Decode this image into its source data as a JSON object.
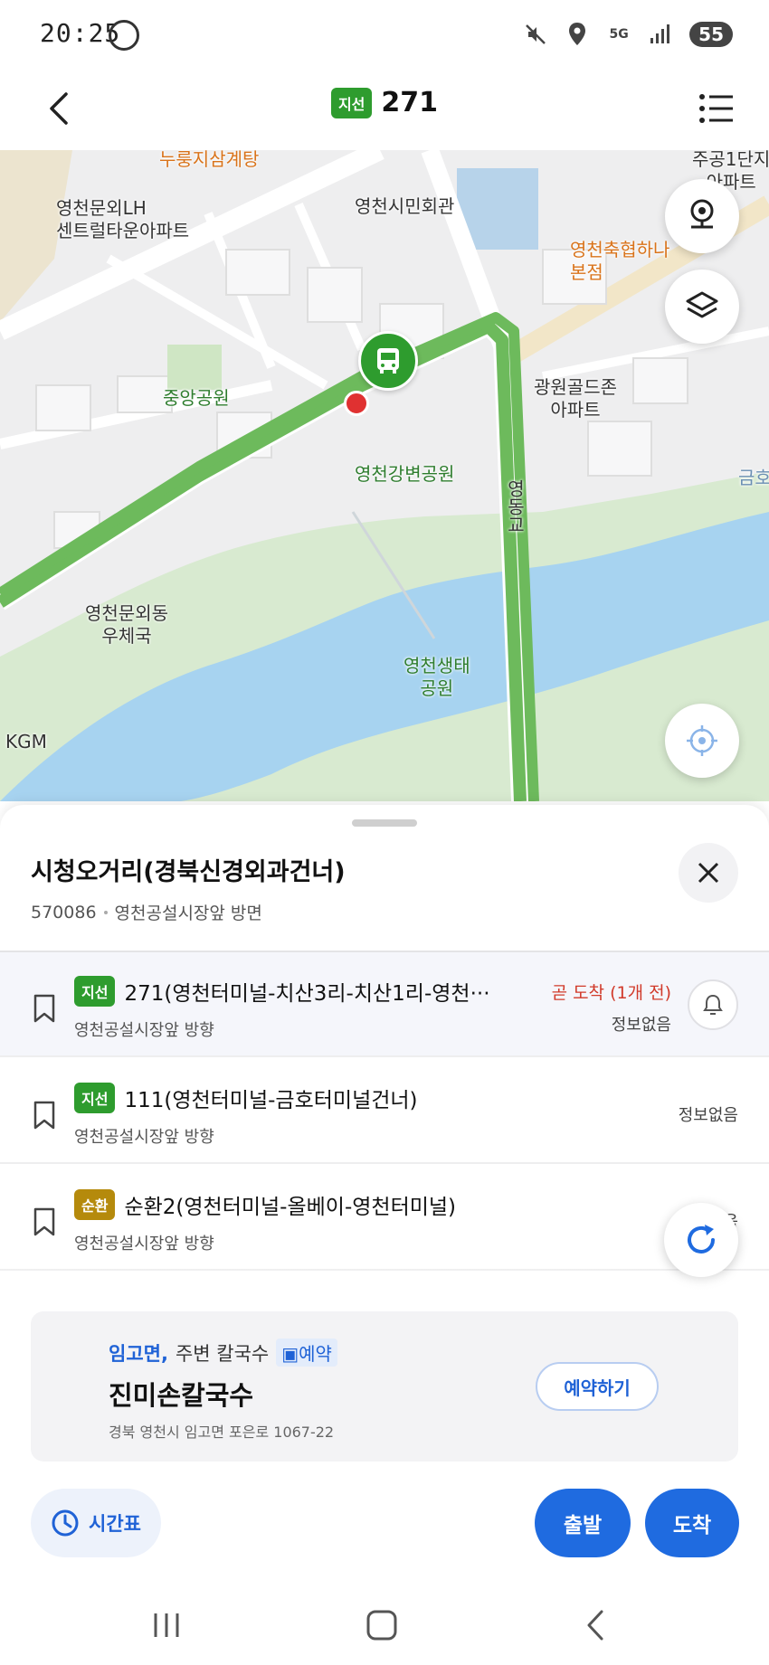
{
  "status_bar": {
    "time": "20:25",
    "network": "5G",
    "battery": "55"
  },
  "header": {
    "route_badge": "지선",
    "route_number": "271"
  },
  "map": {
    "labels": {
      "restaurant": "누룽지삼계탕",
      "apartment_lh": "영천문외LH\n센트럴타운아파트",
      "civic_hall": "영천시민회관",
      "apartment_right_top": "주공1단지\n아파트",
      "festival": "영천축협하나\n본점",
      "gwangwon": "광원골드존\n아파트",
      "central_park": "중앙공원",
      "riverside_park": "영천강변공원",
      "post_office": "영천문외동\n우체국",
      "kgm": "KGM",
      "eco_park": "영천생태\n공원",
      "bridge": "영동교",
      "river_right": "금호"
    }
  },
  "sheet": {
    "stop_name": "시청오거리(경북신경외과건너)",
    "stop_id": "570086",
    "stop_direction": "영천공설시장앞 방면",
    "routes": [
      {
        "badge": "지선",
        "name": "271(영천터미널-치산3리-치산1리-영천···",
        "direction": "영천공설시장앞 방향",
        "status": "곧 도착 (1개 전)",
        "info": "정보없음"
      },
      {
        "badge": "지선",
        "name": "111(영천터미널-금호터미널건너)",
        "direction": "영천공설시장앞 방향",
        "info": "정보없음"
      },
      {
        "badge": "순환",
        "name": "순환2(영천터미널-올베이-영천터미널)",
        "direction": "영천공설시장앞 방향",
        "info": "정보없음"
      }
    ]
  },
  "ad": {
    "location": "임고면,",
    "category": "주변 칼국수",
    "reserve_tag": "예약",
    "name": "진미손칼국수",
    "address": "경북 영천시 임고면 포은로 1067-22",
    "button": "예약하기"
  },
  "actions": {
    "timetable": "시간표",
    "depart": "출발",
    "arrive": "도착"
  },
  "colors": {
    "route_green": "#2e9c2e",
    "accent_blue": "#1f6be0",
    "alert_red": "#d13a2a",
    "circular_orange": "#b58a0c"
  }
}
